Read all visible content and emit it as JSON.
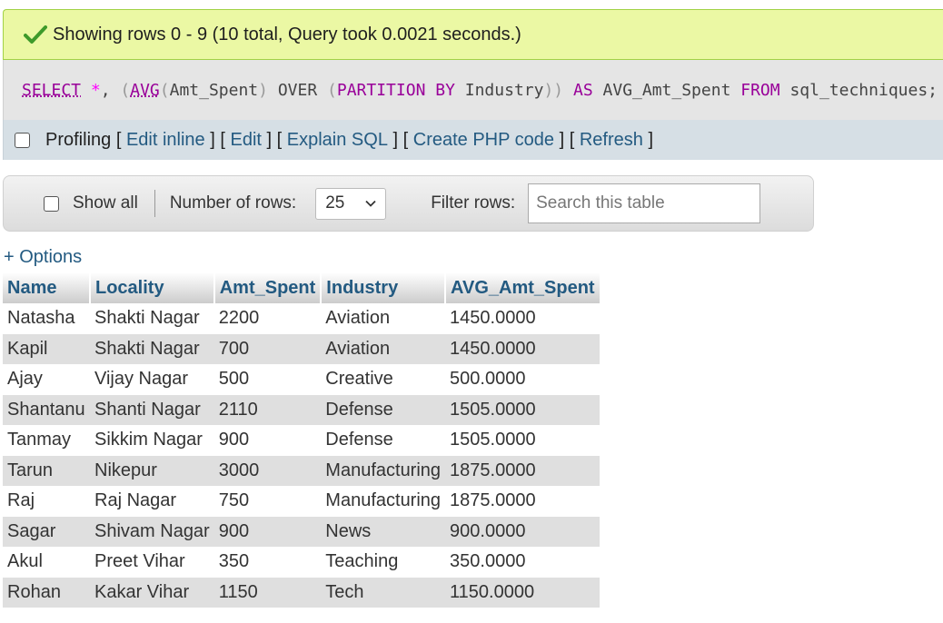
{
  "message": {
    "icon": "checkmark-icon",
    "text": "Showing rows 0 - 9 (10 total, Query took 0.0021 seconds.)"
  },
  "sql": {
    "tokens": [
      {
        "t": "SELECT",
        "c": "kw-u"
      },
      {
        "t": " ",
        "c": "id"
      },
      {
        "t": "*",
        "c": "op"
      },
      {
        "t": ", ",
        "c": "id"
      },
      {
        "t": "(",
        "c": "pn"
      },
      {
        "t": "AVG",
        "c": "fn"
      },
      {
        "t": "(",
        "c": "pn"
      },
      {
        "t": "Amt_Spent",
        "c": "id"
      },
      {
        "t": ")",
        "c": "pn"
      },
      {
        "t": " OVER ",
        "c": "id"
      },
      {
        "t": "(",
        "c": "pn"
      },
      {
        "t": "PARTITION BY",
        "c": "kw"
      },
      {
        "t": " Industry",
        "c": "id"
      },
      {
        "t": "))",
        "c": "pn"
      },
      {
        "t": " ",
        "c": "id"
      },
      {
        "t": "AS",
        "c": "kw"
      },
      {
        "t": " AVG_Amt_Spent ",
        "c": "id"
      },
      {
        "t": "FROM",
        "c": "kw"
      },
      {
        "t": " sql_techniques;",
        "c": "id"
      }
    ]
  },
  "tools": {
    "profiling_label": "Profiling",
    "edit_inline": "Edit inline",
    "edit": "Edit",
    "explain_sql": "Explain SQL",
    "create_php": "Create PHP code",
    "refresh": "Refresh",
    "open_bracket": "[",
    "close_bracket": "]"
  },
  "nav": {
    "show_all_label": "Show all",
    "rows_label": "Number of rows:",
    "rows_value": "25",
    "filter_label": "Filter rows:",
    "search_placeholder": "Search this table"
  },
  "options_link": "+ Options",
  "table": {
    "columns": [
      "Name",
      "Locality",
      "Amt_Spent",
      "Industry",
      "AVG_Amt_Spent"
    ],
    "rows": [
      [
        "Natasha",
        "Shakti Nagar",
        "2200",
        "Aviation",
        "1450.0000"
      ],
      [
        "Kapil",
        "Shakti Nagar",
        "700",
        "Aviation",
        "1450.0000"
      ],
      [
        "Ajay",
        "Vijay Nagar",
        "500",
        "Creative",
        "500.0000"
      ],
      [
        "Shantanu",
        "Shanti Nagar",
        "2110",
        "Defense",
        "1505.0000"
      ],
      [
        "Tanmay",
        "Sikkim Nagar",
        "900",
        "Defense",
        "1505.0000"
      ],
      [
        "Tarun",
        "Nikepur",
        "3000",
        "Manufacturing",
        "1875.0000"
      ],
      [
        "Raj",
        "Raj Nagar",
        "750",
        "Manufacturing",
        "1875.0000"
      ],
      [
        "Sagar",
        "Shivam Nagar",
        "900",
        "News",
        "900.0000"
      ],
      [
        "Akul",
        "Preet Vihar",
        "350",
        "Teaching",
        "350.0000"
      ],
      [
        "Rohan",
        "Kakar Vihar",
        "1150",
        "Tech",
        "1150.0000"
      ]
    ]
  }
}
